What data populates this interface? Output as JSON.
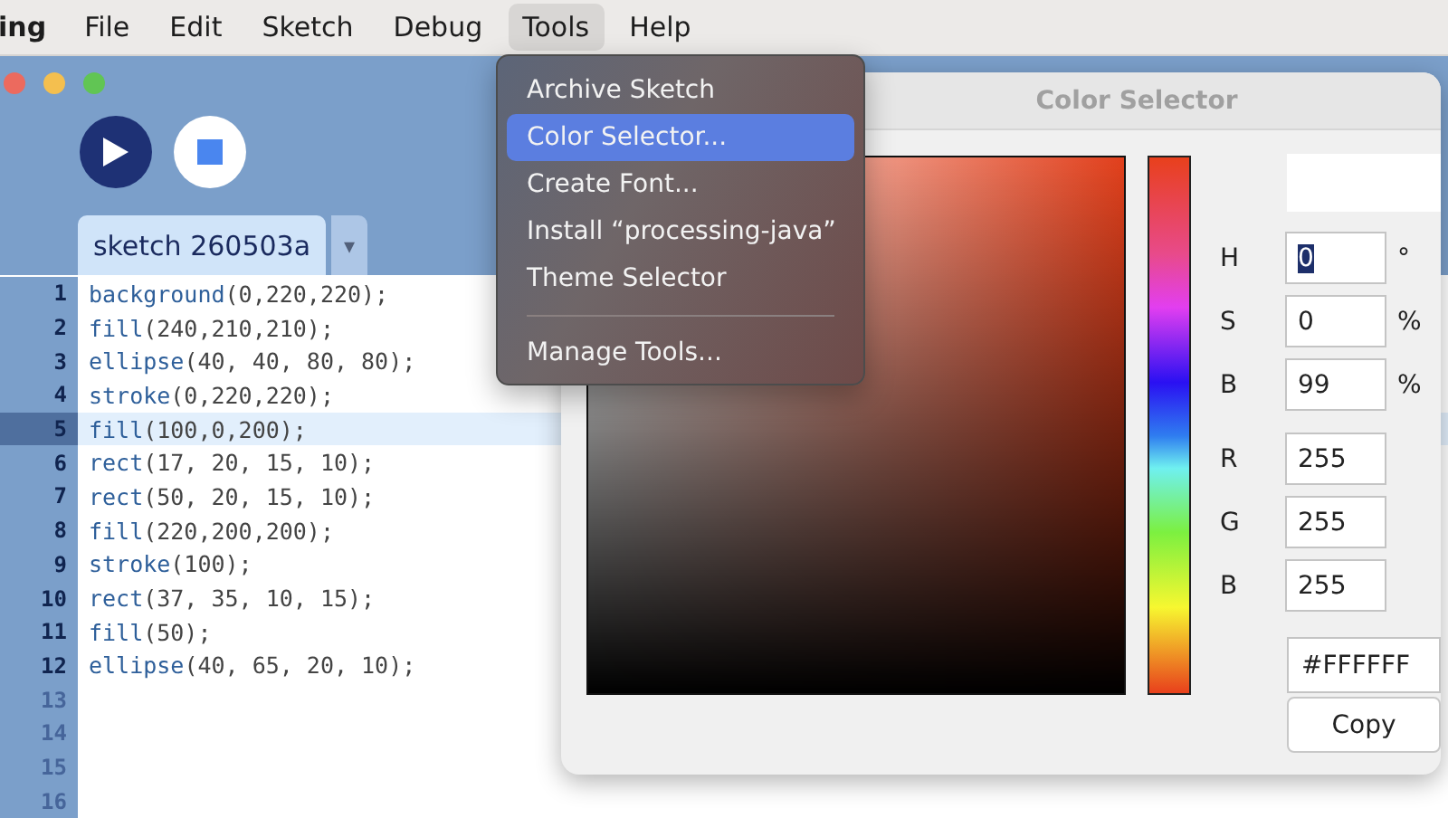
{
  "menu_bar": {
    "app_name": "ing",
    "items": [
      {
        "label": "File",
        "selected": false
      },
      {
        "label": "Edit",
        "selected": false
      },
      {
        "label": "Sketch",
        "selected": false
      },
      {
        "label": "Debug",
        "selected": false
      },
      {
        "label": "Tools",
        "selected": true
      },
      {
        "label": "Help",
        "selected": false
      }
    ]
  },
  "tools_menu": [
    {
      "kind": "item",
      "label": "Archive Sketch",
      "selected": false
    },
    {
      "kind": "item",
      "label": "Color Selector...",
      "selected": true
    },
    {
      "kind": "item",
      "label": "Create Font...",
      "selected": false
    },
    {
      "kind": "item",
      "label": "Install “processing-java”",
      "selected": false
    },
    {
      "kind": "item",
      "label": "Theme Selector",
      "selected": false
    },
    {
      "kind": "separator"
    },
    {
      "kind": "item",
      "label": "Manage Tools...",
      "selected": false
    }
  ],
  "editor": {
    "tab": "sketch 260503a",
    "tab_menu": "▾",
    "lines": [
      {
        "number": "1",
        "code": "background(0,220,220);",
        "selected": false
      },
      {
        "number": "2",
        "code": "fill(240,210,210);",
        "selected": false
      },
      {
        "number": "3",
        "code": "ellipse(40, 40, 80, 80);",
        "selected": false
      },
      {
        "number": "4",
        "code": "stroke(0,220,220);",
        "selected": false
      },
      {
        "number": "5",
        "code": "fill(100,0,200);",
        "selected": true
      },
      {
        "number": "6",
        "code": "rect(17, 20, 15, 10);",
        "selected": false
      },
      {
        "number": "7",
        "code": "rect(50, 20, 15, 10);",
        "selected": false
      },
      {
        "number": "8",
        "code": "fill(220,200,200);",
        "selected": false
      },
      {
        "number": "9",
        "code": "stroke(100);",
        "selected": false
      },
      {
        "number": "10",
        "code": "rect(37, 35, 10, 15);",
        "selected": false
      },
      {
        "number": "11",
        "code": "fill(50);",
        "selected": false
      },
      {
        "number": "12",
        "code": "ellipse(40, 65, 20, 10);",
        "selected": false
      },
      {
        "number": "13",
        "selected": false
      },
      {
        "number": "14",
        "selected": false
      },
      {
        "number": "15",
        "selected": false
      },
      {
        "number": "16",
        "selected": false
      }
    ]
  },
  "color_selector": {
    "title": "Color Selector",
    "fields": [
      {
        "label": "H",
        "value": "0",
        "unit": "°",
        "focused": true
      },
      {
        "label": "S",
        "value": "0",
        "unit": "%",
        "focused": false
      },
      {
        "label": "B",
        "value": "99",
        "unit": "%",
        "focused": false
      },
      {
        "label": "R",
        "value": "255",
        "focused": false
      },
      {
        "label": "G",
        "value": "255",
        "focused": false
      },
      {
        "label": "B",
        "value": "255",
        "focused": false
      }
    ],
    "hex": "#FFFFFF",
    "copy_button": "Copy"
  }
}
